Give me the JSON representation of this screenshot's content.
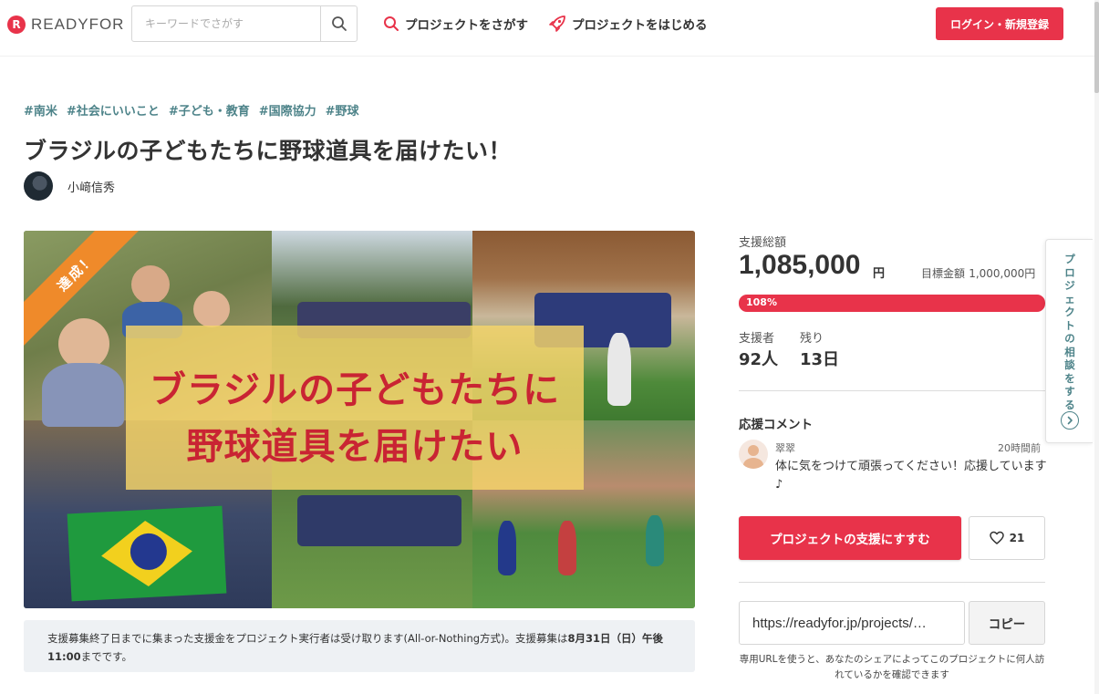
{
  "header": {
    "brand": "READYFOR",
    "search_placeholder": "キーワードでさがす",
    "nav_find": "プロジェクトをさがす",
    "nav_start": "プロジェクトをはじめる",
    "login": "ログイン・新規登録"
  },
  "project": {
    "tags": [
      "#南米",
      "#社会にいいこと",
      "#子ども・教育",
      "#国際協力",
      "#野球"
    ],
    "title": "ブラジルの子どもたちに野球道具を届けたい！",
    "owner": "小﨑信秀",
    "hero_line1": "ブラジルの子どもたちに",
    "hero_line2": "野球道具を届けたい",
    "ribbon": "達成！",
    "notice_part1": "支援募集終了日までに集まった支援金をプロジェクト実行者は受け取ります(All-or-Nothing方式)。支援募集は",
    "notice_bold": "8月31日（日）午後11:00",
    "notice_part2": "までです。"
  },
  "stats": {
    "total_label": "支援総額",
    "total_amount": "1,085,000",
    "yen": "円",
    "goal_label": "目標金額",
    "goal_amount": "1,000,000円",
    "progress_label": "108%",
    "progress_percent": 108,
    "supporters_label": "支援者",
    "supporters": "92人",
    "remaining_label": "残り",
    "remaining": "13日"
  },
  "comments": {
    "title": "応援コメント",
    "items": [
      {
        "name": "翠翠",
        "time": "20時間前",
        "text": "体に気をつけて頑張ってください！応援しています♪"
      }
    ]
  },
  "actions": {
    "support_button": "プロジェクトの支援にすすむ",
    "like_count": "21",
    "share_url": "https://readyfor.jp/projects/…",
    "copy_button": "コピー",
    "url_note": "専用URLを使うと、あなたのシェアによってこのプロジェクトに何人訪れているかを確認できます"
  },
  "side_tab": {
    "label": "プロジェクトの相談をする"
  },
  "colors": {
    "accent": "#e8334a",
    "tag": "#4d8389",
    "ribbon": "#ef8a2a",
    "banner": "#f6d66a"
  }
}
